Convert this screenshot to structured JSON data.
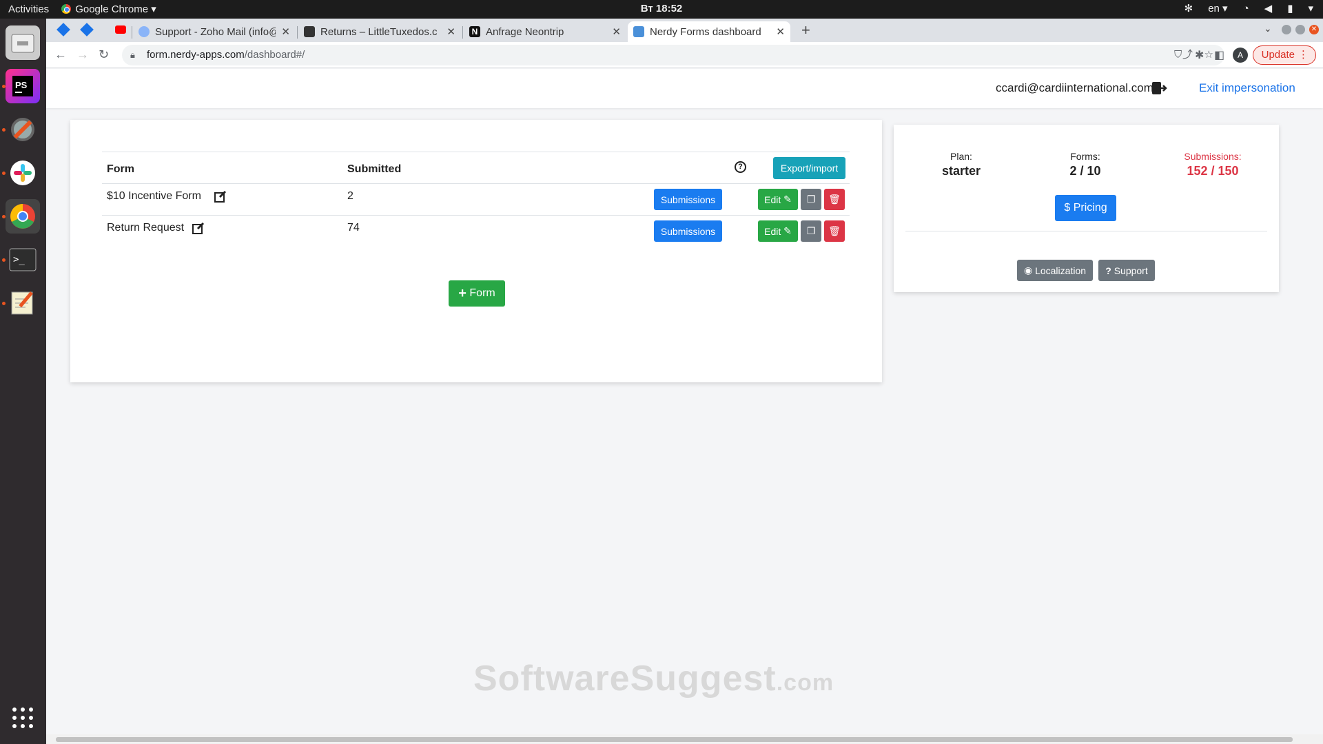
{
  "system": {
    "activities": "Activities",
    "app_name": "Google Chrome",
    "clock": "Вт 18:52",
    "lang": "en"
  },
  "browser": {
    "tabs": [
      {
        "title": "Support - Zoho Mail (info@",
        "favicon_color": "#8ab4f8"
      },
      {
        "title": "Returns – LittleTuxedos.c",
        "favicon_color": "#333333"
      },
      {
        "title": "Anfrage Neontrip",
        "favicon_color": "#111111"
      },
      {
        "title": "Nerdy Forms dashboard",
        "favicon_color": "#4a90d9"
      }
    ],
    "url_host": "form.nerdy-apps.com",
    "url_path": "/dashboard#/",
    "profile_initial": "A",
    "update_label": "Update"
  },
  "header": {
    "user_email": "ccardi@cardiinternational.com",
    "exit_label": "Exit impersonation"
  },
  "forms_table": {
    "col_form": "Form",
    "col_submitted": "Submitted",
    "export_label": "Export/import",
    "help_symbol": "?",
    "rows": [
      {
        "name": "$10 Incentive Form",
        "submitted": "2",
        "submissions_label": "Submissions",
        "edit_label": "Edit"
      },
      {
        "name": "Return Request",
        "submitted": "74",
        "submissions_label": "Submissions",
        "edit_label": "Edit"
      }
    ],
    "add_form_label": "Form"
  },
  "plan_card": {
    "plan_label": "Plan:",
    "plan_value": "starter",
    "forms_label": "Forms:",
    "forms_value": "2 / 10",
    "subs_label": "Submissions:",
    "subs_value": "152 / 150",
    "pricing_label": "Pricing",
    "localization_label": "Localization",
    "support_label": "Support"
  },
  "watermark": {
    "main": "SoftwareSuggest",
    "suffix": ".com"
  },
  "colors": {
    "primary": "#1a7cf0",
    "success": "#28a745",
    "danger": "#dc3545",
    "secondary": "#6c757d",
    "teal": "#17a2b8"
  }
}
